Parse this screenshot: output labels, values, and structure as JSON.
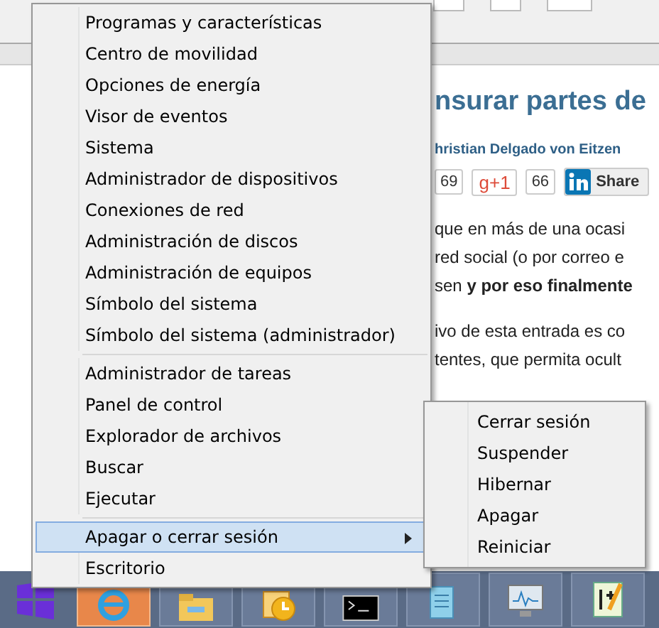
{
  "article": {
    "title": "nsurar partes de",
    "author": "hristian Delgado von Eitzen",
    "share": [
      {
        "kind": "count",
        "text": "69"
      },
      {
        "kind": "gplus",
        "text": "g+1",
        "count": "66"
      },
      {
        "kind": "linkedin",
        "text": "Share"
      }
    ],
    "paragraphs": [
      [
        "que en más de una ocasi",
        "red social (o por correo e",
        "sen **y por eso finalmente**"
      ],
      [
        "ivo de esta entrada es co",
        "tentes, que permita ocult"
      ]
    ]
  },
  "menu": {
    "groups": [
      {
        "items": [
          {
            "label": "Programas y características",
            "selected": false,
            "kind": "item"
          },
          {
            "label": "Centro de movilidad",
            "selected": false,
            "kind": "item"
          },
          {
            "label": "Opciones de energía",
            "selected": false,
            "kind": "item"
          },
          {
            "label": "Visor de eventos",
            "selected": false,
            "kind": "item"
          },
          {
            "label": "Sistema",
            "selected": false,
            "kind": "item"
          },
          {
            "label": "Administrador de dispositivos",
            "selected": false,
            "kind": "item"
          },
          {
            "label": "Conexiones de red",
            "selected": false,
            "kind": "item"
          },
          {
            "label": "Administración de discos",
            "selected": false,
            "kind": "item"
          },
          {
            "label": "Administración de equipos",
            "selected": false,
            "kind": "item"
          },
          {
            "label": "Símbolo del sistema",
            "selected": false,
            "kind": "item"
          },
          {
            "label": "Símbolo del sistema (administrador)",
            "selected": false,
            "kind": "item"
          }
        ]
      },
      {
        "items": [
          {
            "label": "Administrador de tareas",
            "selected": false,
            "kind": "item"
          },
          {
            "label": "Panel de control",
            "selected": false,
            "kind": "item"
          },
          {
            "label": "Explorador de archivos",
            "selected": false,
            "kind": "item"
          },
          {
            "label": "Buscar",
            "selected": false,
            "kind": "item"
          },
          {
            "label": "Ejecutar",
            "selected": false,
            "kind": "item"
          }
        ]
      },
      {
        "items": [
          {
            "label": "Apagar o cerrar sesión",
            "selected": true,
            "kind": "submenu"
          },
          {
            "label": "Escritorio",
            "selected": false,
            "kind": "item"
          }
        ]
      }
    ]
  },
  "submenu": {
    "items": [
      "Cerrar sesión",
      "Suspender",
      "Hibernar",
      "Apagar",
      "Reiniciar"
    ]
  },
  "taskbar": {
    "apps": [
      {
        "kind": "browser",
        "selected": true
      },
      {
        "kind": "folder",
        "selected": false
      },
      {
        "kind": "clock",
        "selected": false
      },
      {
        "kind": "terminal",
        "selected": false
      },
      {
        "kind": "notepad",
        "selected": false
      },
      {
        "kind": "monitor",
        "selected": false
      },
      {
        "kind": "editor",
        "selected": false
      }
    ]
  }
}
